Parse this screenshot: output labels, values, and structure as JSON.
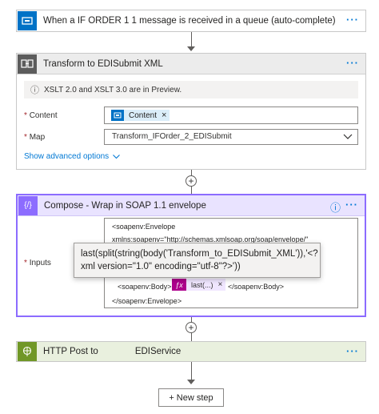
{
  "trigger": {
    "title": "When a IF ORDER 1 1 message is received in a queue (auto-complete)",
    "color": "#0072c6"
  },
  "transform": {
    "title": "Transform to EDISubmit XML",
    "color": "#5c5c5c",
    "notice": "XSLT 2.0 and XSLT 3.0 are in Preview.",
    "content_label": "Content",
    "content_token": "Content",
    "map_label": "Map",
    "map_value": "Transform_IFOrder_2_EDISubmit",
    "advanced_link": "Show advanced options"
  },
  "compose": {
    "title": "Compose - Wrap in SOAP 1.1 envelope",
    "color": "#8c6cff",
    "inputs_label": "Inputs",
    "code_lines": [
      "<soapenv:Envelope",
      "xmlns:soapenv=\"http://schemas.xmlsoap.org/soap/envelope/\""
    ],
    "body_open": "<soapenv:Body>",
    "expr_token": "last(...)",
    "body_close": "</soapenv:Body>",
    "envelope_close": "</soapenv:Envelope>",
    "tooltip": "last(split(string(body('Transform_to_EDISubmit_XML')),'<?xml version=\"1.0\" encoding=\"utf-8\"?>'))"
  },
  "http": {
    "title": "HTTP Post to",
    "title_suffix": "EDIService",
    "color": "#709727"
  },
  "new_step": "+ New step",
  "required_mark": "*",
  "ellipsis": "···",
  "close_glyph": "×",
  "info_glyph": "ⓘ",
  "plus_glyph": "+",
  "fx_glyph": "ƒx"
}
